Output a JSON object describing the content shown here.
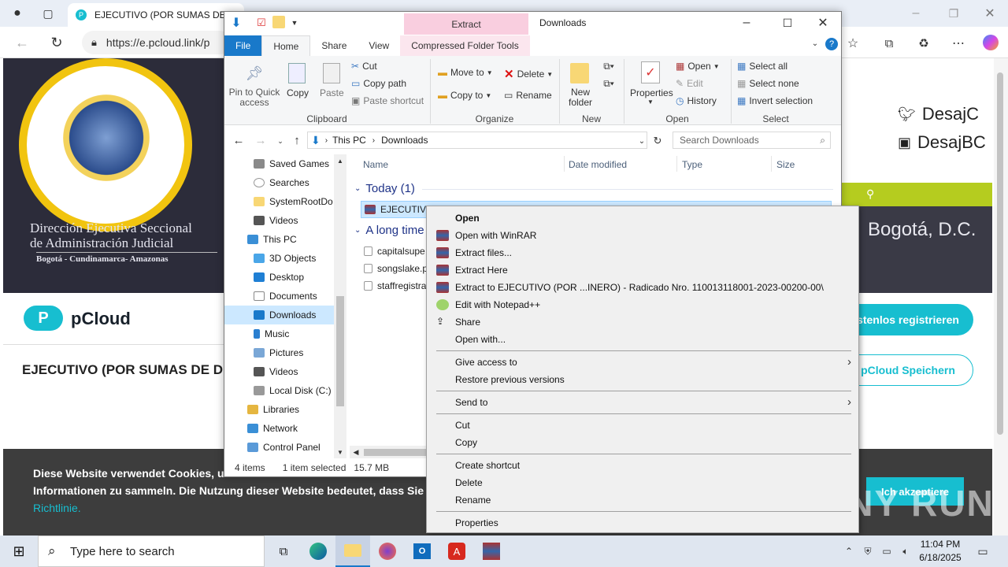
{
  "browser": {
    "tab_title": "EJECUTIVO (POR SUMAS DE DIN",
    "url": "https://e.pcloud.link/p"
  },
  "webpage": {
    "org_line1": "Dirección Ejecutiva Seccional",
    "org_line2": "de Administración Judicial",
    "org_sub": "Bogotá - Cundinamarca- Amazonas",
    "pcloud": "pCloud",
    "file_title": "EJECUTIVO (POR SUMAS DE DI",
    "social1": "DesajC",
    "social2": "DesajBC",
    "city": "Bogotá, D.C.",
    "register_btn": "stenlos registrieren",
    "save_btn": "pCloud Speichern",
    "cookie_line1": "Diese Website verwendet Cookies, um",
    "cookie_line2": "Informationen zu sammeln. Die Nutzung dieser Website bedeutet, dass Sie damit",
    "cookie_link": "Richtlinie.",
    "cookie_accept": "Ich akzeptiere"
  },
  "explorer": {
    "title": "Downloads",
    "contextual_tab": "Extract",
    "tabs": [
      "File",
      "Home",
      "Share",
      "View",
      "Compressed Folder Tools"
    ],
    "clipboard": {
      "pin": "Pin to Quick access",
      "copy": "Copy",
      "paste": "Paste",
      "cut": "Cut",
      "copy_path": "Copy path",
      "paste_shortcut": "Paste shortcut",
      "label": "Clipboard"
    },
    "organize": {
      "move_to": "Move to",
      "copy_to": "Copy to",
      "delete": "Delete",
      "rename": "Rename",
      "label": "Organize"
    },
    "new": {
      "new_folder": "New folder",
      "label": "New"
    },
    "open": {
      "properties": "Properties",
      "open": "Open",
      "edit": "Edit",
      "history": "History",
      "label": "Open"
    },
    "select": {
      "all": "Select all",
      "none": "Select none",
      "invert": "Invert selection",
      "label": "Select"
    },
    "path": [
      "This PC",
      "Downloads"
    ],
    "search_placeholder": "Search Downloads",
    "nav": [
      "Saved Games",
      "Searches",
      "SystemRootDo",
      "Videos",
      "This PC",
      "3D Objects",
      "Desktop",
      "Documents",
      "Downloads",
      "Music",
      "Pictures",
      "Videos",
      "Local Disk (C:)",
      "Libraries",
      "Network",
      "Control Panel"
    ],
    "columns": [
      "Name",
      "Date modified",
      "Type",
      "Size"
    ],
    "group_today": "Today (1)",
    "group_long": "A long time",
    "files": [
      "EJECUTIVO",
      "capitalsupe",
      "songslake.p",
      "staffregistra"
    ],
    "status_items": "4 items",
    "status_selected": "1 item selected",
    "status_size": "15.7 MB"
  },
  "context_menu": {
    "items": [
      "Open",
      "Open with WinRAR",
      "Extract files...",
      "Extract Here",
      "Extract to EJECUTIVO (POR ...INERO) - Radicado Nro. 110013118001-2023-00200-00\\",
      "Edit with Notepad++",
      "Share",
      "Open with...",
      "Give access to",
      "Restore previous versions",
      "Send to",
      "Cut",
      "Copy",
      "Create shortcut",
      "Delete",
      "Rename",
      "Properties"
    ]
  },
  "taskbar": {
    "search_placeholder": "Type here to search",
    "time": "11:04 PM",
    "date": "6/18/2025"
  },
  "watermark": "ANY RUN"
}
